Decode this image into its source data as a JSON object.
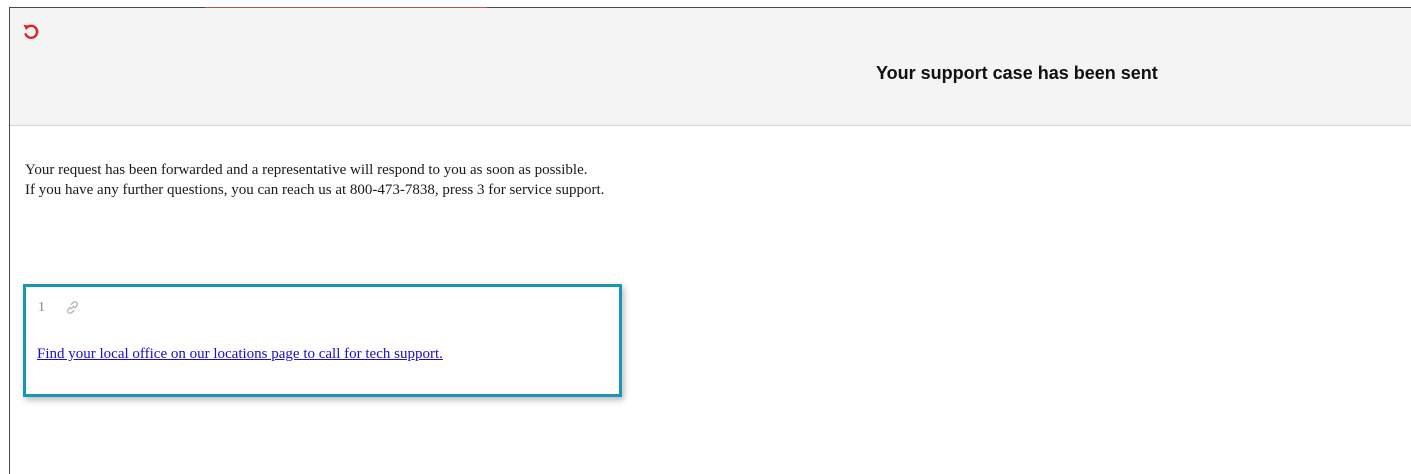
{
  "header": {
    "title": "Your support case has been sent",
    "back_icon": "undo-arrow-icon",
    "accent_color": "#e02020"
  },
  "message": {
    "line1": "Your request has been forwarded and a representative will respond to you as soon as possible.",
    "line2": "If you have any further questions, you can reach us at 800-473-7838, press 3 for service support."
  },
  "callout": {
    "index": "1",
    "link_icon": "link-icon",
    "link_text": "Find your local office on our locations page to call for tech support.",
    "border_color": "#1796b8",
    "link_color": "#1a0dcc"
  }
}
